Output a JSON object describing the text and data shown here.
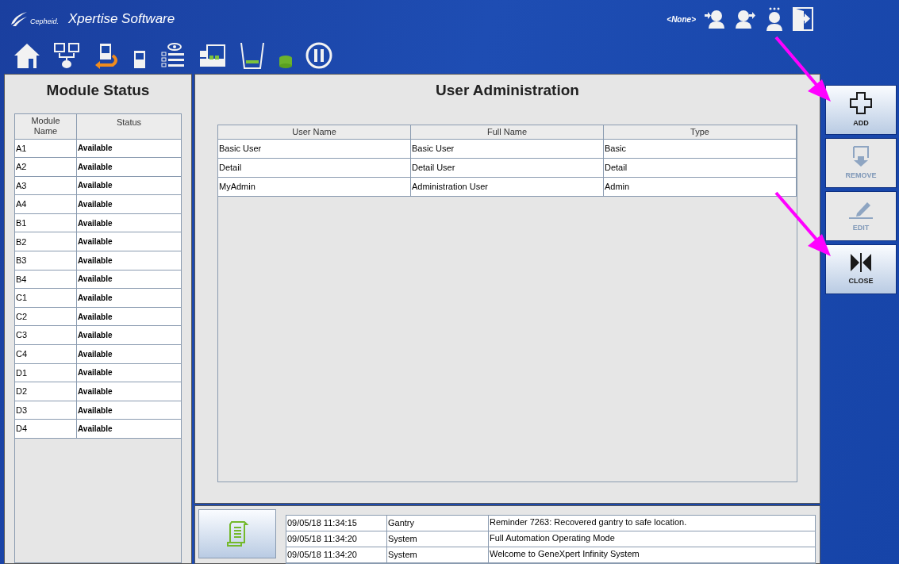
{
  "header": {
    "brand": "Cepheid.",
    "title": "Xpertise Software",
    "user": "<None>"
  },
  "module_status": {
    "title": "Module Status",
    "columns": [
      "Module Name",
      "Status"
    ],
    "rows": [
      {
        "name": "A1",
        "status": "Available"
      },
      {
        "name": "A2",
        "status": "Available"
      },
      {
        "name": "A3",
        "status": "Available"
      },
      {
        "name": "A4",
        "status": "Available"
      },
      {
        "name": "B1",
        "status": "Available"
      },
      {
        "name": "B2",
        "status": "Available"
      },
      {
        "name": "B3",
        "status": "Available"
      },
      {
        "name": "B4",
        "status": "Available"
      },
      {
        "name": "C1",
        "status": "Available"
      },
      {
        "name": "C2",
        "status": "Available"
      },
      {
        "name": "C3",
        "status": "Available"
      },
      {
        "name": "C4",
        "status": "Available"
      },
      {
        "name": "D1",
        "status": "Available"
      },
      {
        "name": "D2",
        "status": "Available"
      },
      {
        "name": "D3",
        "status": "Available"
      },
      {
        "name": "D4",
        "status": "Available"
      }
    ]
  },
  "user_admin": {
    "title": "User Administration",
    "columns": [
      "User Name",
      "Full Name",
      "Type"
    ],
    "rows": [
      [
        "Basic User",
        "Basic User",
        "Basic"
      ],
      [
        "Detail",
        "Detail User",
        "Detail"
      ],
      [
        "MyAdmin",
        "Administration User",
        "Admin"
      ]
    ]
  },
  "actions": [
    {
      "kind": "add",
      "label": "ADD",
      "disabled": false
    },
    {
      "kind": "remove",
      "label": "REMOVE",
      "disabled": true
    },
    {
      "kind": "edit",
      "label": "EDIT",
      "disabled": true
    },
    {
      "kind": "close",
      "label": "CLOSE",
      "disabled": false
    }
  ],
  "log": [
    [
      "09/05/18 11:34:15",
      "Gantry",
      "Reminder 7263: Recovered gantry to safe location."
    ],
    [
      "09/05/18 11:34:20",
      "System",
      "Full Automation Operating Mode"
    ],
    [
      "09/05/18 11:34:20",
      "System",
      "Welcome to GeneXpert Infinity System"
    ]
  ]
}
